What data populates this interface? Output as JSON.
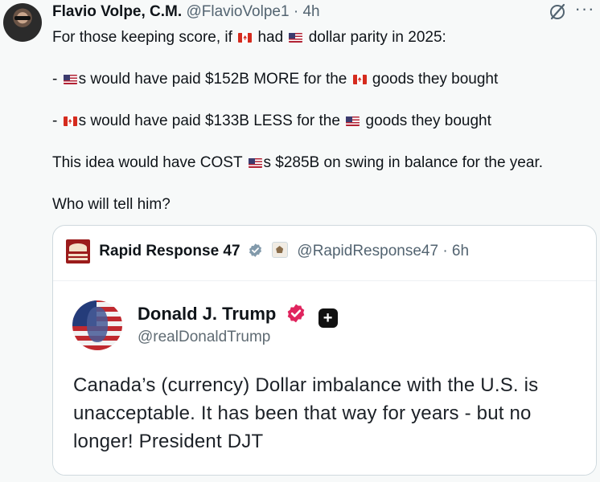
{
  "author": {
    "name": "Flavio Volpe, C.M.",
    "handle": "@FlavioVolpe1",
    "separator": "·",
    "time": "4h"
  },
  "icons": {
    "avatar": "profile-photo",
    "grok": "slashed-circle-icon",
    "more": "more-icon",
    "canada": "canada-flag-emoji",
    "usa": "us-flag-emoji"
  },
  "body": {
    "line1_a": "For those keeping score, if",
    "line1_b": "had",
    "line1_c": "dollar parity in 2025:",
    "line2_a": "-",
    "line2_b": "s would have paid $152B MORE for the",
    "line2_c": "goods they bought",
    "line3_a": "-",
    "line3_b": "s would have paid $133B LESS for the",
    "line3_c": "goods they bought",
    "line4_a": "This idea would have COST",
    "line4_b": "s $285B on swing in balance for the year.",
    "line5": "Who will tell him?"
  },
  "quote": {
    "name": "Rapid Response 47",
    "handle": "@RapidResponse47",
    "separator": "·",
    "time": "6h"
  },
  "embedded_post": {
    "name": "Donald J. Trump",
    "handle": "@realDonaldTrump",
    "plus": "+",
    "text": "Canada’s (currency) Dollar imbalance with the U.S. is unacceptable. It has been that way for years - but no longer! President DJT"
  },
  "colors": {
    "text": "#0f1419",
    "muted": "#536471",
    "border": "#cfd9de",
    "verified_pink": "#e0245e"
  }
}
